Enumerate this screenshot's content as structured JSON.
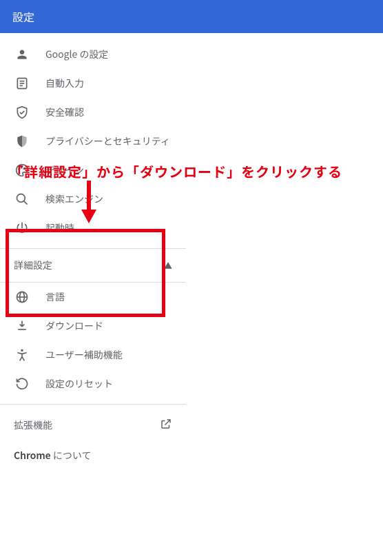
{
  "header": {
    "title": "設定"
  },
  "annotation": {
    "text": "「詳細設定」から「ダウンロード」をクリックする"
  },
  "menu": {
    "items": [
      {
        "icon": "person",
        "label": "Google の設定"
      },
      {
        "icon": "autofill",
        "label": "自動入力"
      },
      {
        "icon": "shield-check",
        "label": "安全確認"
      },
      {
        "icon": "shield-lock",
        "label": "プライバシーとセキュリティ"
      },
      {
        "icon": "palette",
        "label": "デザイン"
      },
      {
        "icon": "search",
        "label": "検索エンジン"
      },
      {
        "icon": "power",
        "label": "起動時"
      }
    ]
  },
  "advanced": {
    "header": "詳細設定",
    "items": [
      {
        "icon": "globe",
        "label": "言語"
      },
      {
        "icon": "download",
        "label": "ダウンロード"
      },
      {
        "icon": "accessibility",
        "label": "ユーザー補助機能"
      },
      {
        "icon": "restore",
        "label": "設定のリセット"
      }
    ]
  },
  "footer": {
    "extensions": "拡張機能",
    "about_prefix": "Chrome ",
    "about_suffix": "について"
  }
}
